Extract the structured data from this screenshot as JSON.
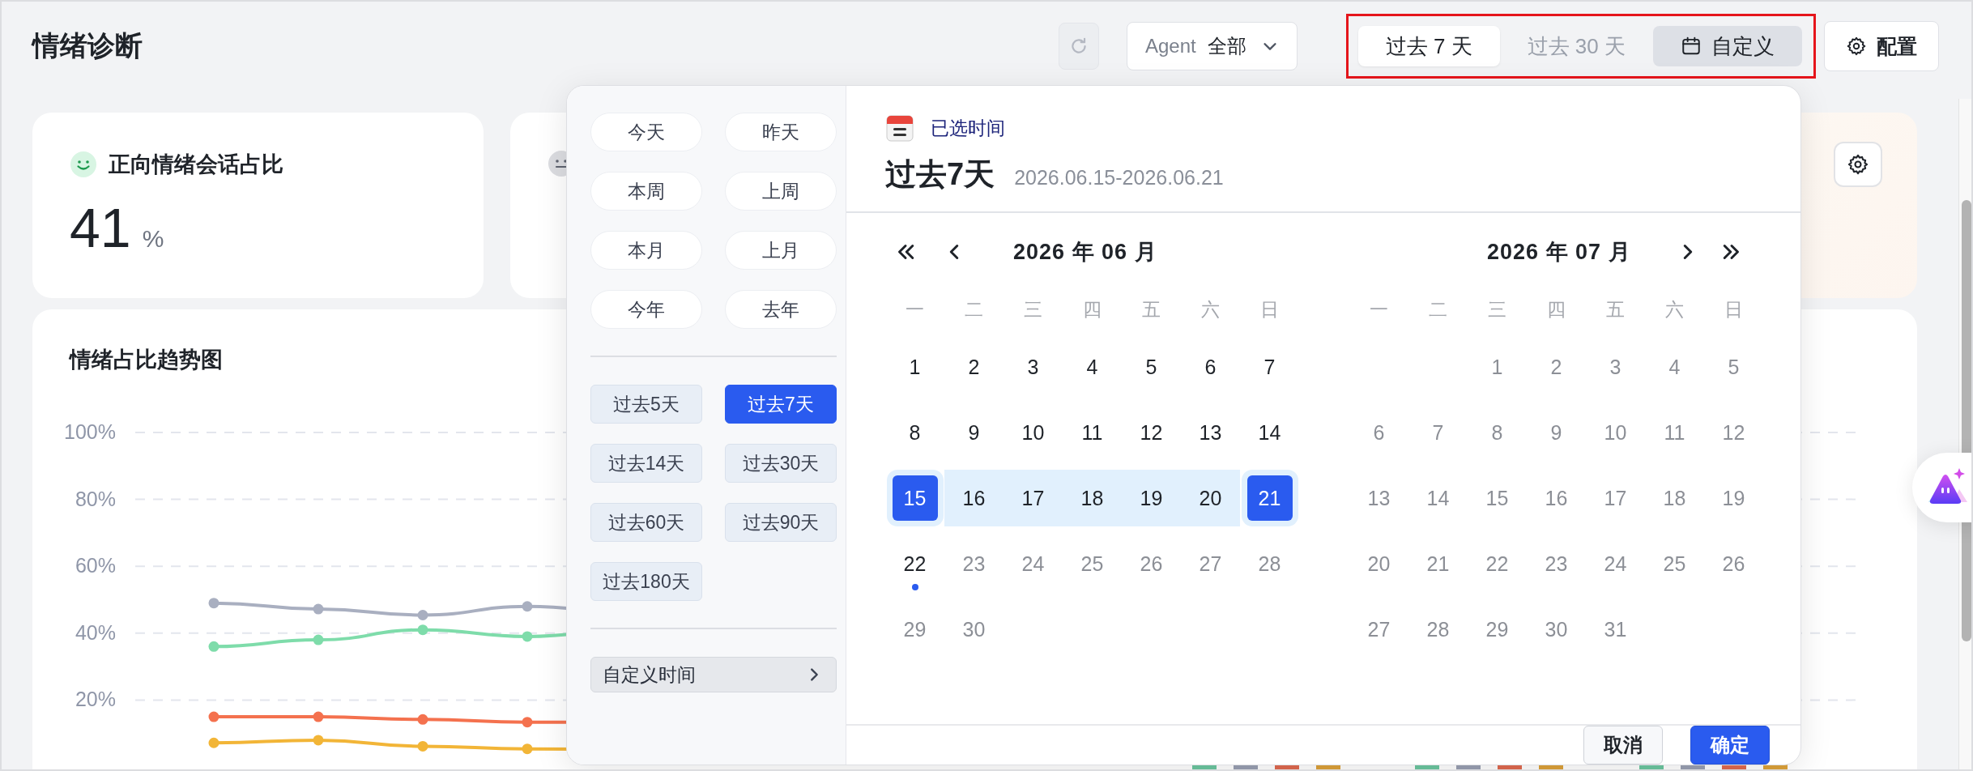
{
  "header": {
    "title": "情绪诊断",
    "agent_filter": {
      "label": "Agent",
      "value": "全部"
    },
    "range_tabs": [
      {
        "label": "过去 7 天",
        "selected": true,
        "open": false,
        "kind": "preset"
      },
      {
        "label": "过去 30 天",
        "selected": false,
        "open": false,
        "kind": "preset"
      },
      {
        "label": "自定义",
        "selected": false,
        "open": true,
        "kind": "custom"
      }
    ],
    "config_button": "配置"
  },
  "metric_cards": [
    {
      "kind": "positive",
      "title": "正向情绪会话占比",
      "value": "41",
      "unit": "%"
    },
    {
      "kind": "neutral"
    },
    {
      "kind": "settings"
    }
  ],
  "trend_chart": {
    "title": "情绪占比趋势图",
    "y_axis_labels": [
      "100%",
      "80%",
      "60%",
      "40%",
      "20%"
    ]
  },
  "date_picker": {
    "quick_ranges": [
      {
        "label": "今天",
        "selected": false
      },
      {
        "label": "昨天",
        "selected": false
      },
      {
        "label": "本周",
        "selected": false
      },
      {
        "label": "上周",
        "selected": false
      },
      {
        "label": "本月",
        "selected": false
      },
      {
        "label": "上月",
        "selected": false
      },
      {
        "label": "今年",
        "selected": false
      },
      {
        "label": "去年",
        "selected": false
      }
    ],
    "recent_ranges": [
      {
        "label": "过去5天",
        "selected": false
      },
      {
        "label": "过去7天",
        "selected": true
      },
      {
        "label": "过去14天",
        "selected": false
      },
      {
        "label": "过去30天",
        "selected": false
      },
      {
        "label": "过去60天",
        "selected": false
      },
      {
        "label": "过去90天",
        "selected": false
      },
      {
        "label": "过去180天",
        "selected": false
      }
    ],
    "custom_time": "自定义时间",
    "selected_heading": "已选时间",
    "selected_label": "过去7天",
    "selected_dates": "2026.06.15-2026.06.21",
    "months": [
      {
        "title": "2026 年 06 月",
        "has_prev": true,
        "has_next": false,
        "weekdays": [
          "一",
          "二",
          "三",
          "四",
          "五",
          "六",
          "日"
        ],
        "weeks": [
          {
            "right_aligned": false,
            "days": [
              {
                "label": "1",
                "disabled": false,
                "selected": false,
                "in_range": false,
                "today": false
              },
              {
                "label": "2",
                "disabled": false,
                "selected": false,
                "in_range": false,
                "today": false
              },
              {
                "label": "3",
                "disabled": false,
                "selected": false,
                "in_range": false,
                "today": false
              },
              {
                "label": "4",
                "disabled": false,
                "selected": false,
                "in_range": false,
                "today": false
              },
              {
                "label": "5",
                "disabled": false,
                "selected": false,
                "in_range": false,
                "today": false
              },
              {
                "label": "6",
                "disabled": false,
                "selected": false,
                "in_range": false,
                "today": false
              },
              {
                "label": "7",
                "disabled": false,
                "selected": false,
                "in_range": false,
                "today": false
              }
            ]
          },
          {
            "right_aligned": false,
            "days": [
              {
                "label": "8",
                "disabled": false,
                "selected": false,
                "in_range": false,
                "today": false
              },
              {
                "label": "9",
                "disabled": false,
                "selected": false,
                "in_range": false,
                "today": false
              },
              {
                "label": "10",
                "disabled": false,
                "selected": false,
                "in_range": false,
                "today": false
              },
              {
                "label": "11",
                "disabled": false,
                "selected": false,
                "in_range": false,
                "today": false
              },
              {
                "label": "12",
                "disabled": false,
                "selected": false,
                "in_range": false,
                "today": false
              },
              {
                "label": "13",
                "disabled": false,
                "selected": false,
                "in_range": false,
                "today": false
              },
              {
                "label": "14",
                "disabled": false,
                "selected": false,
                "in_range": false,
                "today": false
              }
            ]
          },
          {
            "right_aligned": false,
            "days": [
              {
                "label": "15",
                "disabled": false,
                "selected": true,
                "in_range": true,
                "today": false
              },
              {
                "label": "16",
                "disabled": false,
                "selected": false,
                "in_range": true,
                "today": false
              },
              {
                "label": "17",
                "disabled": false,
                "selected": false,
                "in_range": true,
                "today": false
              },
              {
                "label": "18",
                "disabled": false,
                "selected": false,
                "in_range": true,
                "today": false
              },
              {
                "label": "19",
                "disabled": false,
                "selected": false,
                "in_range": true,
                "today": false
              },
              {
                "label": "20",
                "disabled": false,
                "selected": false,
                "in_range": true,
                "today": false
              },
              {
                "label": "21",
                "disabled": false,
                "selected": true,
                "in_range": true,
                "today": false
              }
            ]
          },
          {
            "right_aligned": false,
            "days": [
              {
                "label": "22",
                "disabled": false,
                "selected": false,
                "in_range": false,
                "today": true
              },
              {
                "label": "23",
                "disabled": true,
                "selected": false,
                "in_range": false,
                "today": false
              },
              {
                "label": "24",
                "disabled": true,
                "selected": false,
                "in_range": false,
                "today": false
              },
              {
                "label": "25",
                "disabled": true,
                "selected": false,
                "in_range": false,
                "today": false
              },
              {
                "label": "26",
                "disabled": true,
                "selected": false,
                "in_range": false,
                "today": false
              },
              {
                "label": "27",
                "disabled": true,
                "selected": false,
                "in_range": false,
                "today": false
              },
              {
                "label": "28",
                "disabled": true,
                "selected": false,
                "in_range": false,
                "today": false
              }
            ]
          },
          {
            "right_aligned": false,
            "days": [
              {
                "label": "29",
                "disabled": true,
                "selected": false,
                "in_range": false,
                "today": false
              },
              {
                "label": "30",
                "disabled": true,
                "selected": false,
                "in_range": false,
                "today": false
              }
            ]
          }
        ]
      },
      {
        "title": "2026 年 07 月",
        "has_prev": false,
        "has_next": true,
        "weekdays": [
          "一",
          "二",
          "三",
          "四",
          "五",
          "六",
          "日"
        ],
        "weeks": [
          {
            "right_aligned": true,
            "days": [
              {
                "label": "1",
                "disabled": true,
                "selected": false,
                "in_range": false,
                "today": false
              },
              {
                "label": "2",
                "disabled": true,
                "selected": false,
                "in_range": false,
                "today": false
              },
              {
                "label": "3",
                "disabled": true,
                "selected": false,
                "in_range": false,
                "today": false
              },
              {
                "label": "4",
                "disabled": true,
                "selected": false,
                "in_range": false,
                "today": false
              },
              {
                "label": "5",
                "disabled": true,
                "selected": false,
                "in_range": false,
                "today": false
              }
            ]
          },
          {
            "right_aligned": false,
            "days": [
              {
                "label": "6",
                "disabled": true,
                "selected": false,
                "in_range": false,
                "today": false
              },
              {
                "label": "7",
                "disabled": true,
                "selected": false,
                "in_range": false,
                "today": false
              },
              {
                "label": "8",
                "disabled": true,
                "selected": false,
                "in_range": false,
                "today": false
              },
              {
                "label": "9",
                "disabled": true,
                "selected": false,
                "in_range": false,
                "today": false
              },
              {
                "label": "10",
                "disabled": true,
                "selected": false,
                "in_range": false,
                "today": false
              },
              {
                "label": "11",
                "disabled": true,
                "selected": false,
                "in_range": false,
                "today": false
              },
              {
                "label": "12",
                "disabled": true,
                "selected": false,
                "in_range": false,
                "today": false
              }
            ]
          },
          {
            "right_aligned": false,
            "days": [
              {
                "label": "13",
                "disabled": true,
                "selected": false,
                "in_range": false,
                "today": false
              },
              {
                "label": "14",
                "disabled": true,
                "selected": false,
                "in_range": false,
                "today": false
              },
              {
                "label": "15",
                "disabled": true,
                "selected": false,
                "in_range": false,
                "today": false
              },
              {
                "label": "16",
                "disabled": true,
                "selected": false,
                "in_range": false,
                "today": false
              },
              {
                "label": "17",
                "disabled": true,
                "selected": false,
                "in_range": false,
                "today": false
              },
              {
                "label": "18",
                "disabled": true,
                "selected": false,
                "in_range": false,
                "today": false
              },
              {
                "label": "19",
                "disabled": true,
                "selected": false,
                "in_range": false,
                "today": false
              }
            ]
          },
          {
            "right_aligned": false,
            "days": [
              {
                "label": "20",
                "disabled": true,
                "selected": false,
                "in_range": false,
                "today": false
              },
              {
                "label": "21",
                "disabled": true,
                "selected": false,
                "in_range": false,
                "today": false
              },
              {
                "label": "22",
                "disabled": true,
                "selected": false,
                "in_range": false,
                "today": false
              },
              {
                "label": "23",
                "disabled": true,
                "selected": false,
                "in_range": false,
                "today": false
              },
              {
                "label": "24",
                "disabled": true,
                "selected": false,
                "in_range": false,
                "today": false
              },
              {
                "label": "25",
                "disabled": true,
                "selected": false,
                "in_range": false,
                "today": false
              },
              {
                "label": "26",
                "disabled": true,
                "selected": false,
                "in_range": false,
                "today": false
              }
            ]
          },
          {
            "right_aligned": false,
            "days": [
              {
                "label": "27",
                "disabled": true,
                "selected": false,
                "in_range": false,
                "today": false
              },
              {
                "label": "28",
                "disabled": true,
                "selected": false,
                "in_range": false,
                "today": false
              },
              {
                "label": "29",
                "disabled": true,
                "selected": false,
                "in_range": false,
                "today": false
              },
              {
                "label": "30",
                "disabled": true,
                "selected": false,
                "in_range": false,
                "today": false
              },
              {
                "label": "31",
                "disabled": true,
                "selected": false,
                "in_range": false,
                "today": false
              }
            ]
          }
        ]
      }
    ],
    "buttons": [
      {
        "label": "取消",
        "kind": "secondary"
      },
      {
        "label": "确定",
        "kind": "primary"
      }
    ]
  }
}
